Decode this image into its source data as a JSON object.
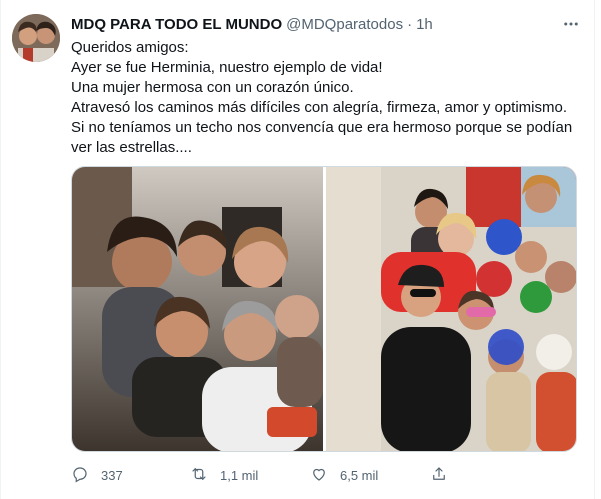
{
  "tweet": {
    "display_name": "MDQ PARA TODO EL MUNDO",
    "handle": "@MDQparatodos",
    "separator": "·",
    "time": "1h",
    "text_lines": [
      "Queridos amigos:",
      "Ayer se fue Herminia, nuestro ejemplo de vida!",
      "Una mujer hermosa con un corazón único.",
      "Atravesó los caminos más difíciles con alegría, firmeza, amor y optimismo.",
      "Si no teníamos un techo nos convencía que era hermoso porque se podían",
      "ver las estrellas...."
    ],
    "photos": [
      {
        "name": "photo-group-selfie-left",
        "description_icon": "photo"
      },
      {
        "name": "photo-group-selfie-right",
        "description_icon": "photo"
      }
    ],
    "actions": {
      "reply_count": "337",
      "retweet_count": "1,1 mil",
      "like_count": "6,5 mil"
    },
    "colors": {
      "text": "#0f1419",
      "secondary": "#536471",
      "border": "#cfd9de"
    },
    "icons": {
      "more": "more-horizontal-icon",
      "reply": "reply-icon",
      "retweet": "retweet-icon",
      "like": "heart-icon",
      "share": "share-icon"
    }
  }
}
